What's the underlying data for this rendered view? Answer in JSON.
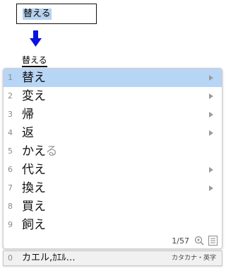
{
  "input": {
    "text": "替える"
  },
  "composing": {
    "text": "替える"
  },
  "candidates": [
    {
      "num": "1",
      "text": "替え",
      "suffix": "",
      "submenu": true
    },
    {
      "num": "2",
      "text": "変え",
      "suffix": "",
      "submenu": true
    },
    {
      "num": "3",
      "text": "帰",
      "suffix": "",
      "submenu": true
    },
    {
      "num": "4",
      "text": "返",
      "suffix": "",
      "submenu": true
    },
    {
      "num": "5",
      "text": "かえ",
      "suffix": "る",
      "submenu": false
    },
    {
      "num": "6",
      "text": "代え",
      "suffix": "",
      "submenu": true
    },
    {
      "num": "7",
      "text": "換え",
      "suffix": "",
      "submenu": true
    },
    {
      "num": "8",
      "text": "買え",
      "suffix": "",
      "submenu": false
    },
    {
      "num": "9",
      "text": "飼え",
      "suffix": "",
      "submenu": false
    }
  ],
  "selected_index": 0,
  "footer": {
    "page": "1/57",
    "zoom_icon": "zoom-in-icon",
    "list_icon": "list-icon"
  },
  "bottom_bar": {
    "num": "0",
    "text": "カエル,ｶｴﾙ…",
    "mode": "カタカナ・英字"
  },
  "colors": {
    "selection": "#b7d5f5",
    "input_highlight": "#b8d2f0",
    "arrow": "#0a14e0"
  }
}
